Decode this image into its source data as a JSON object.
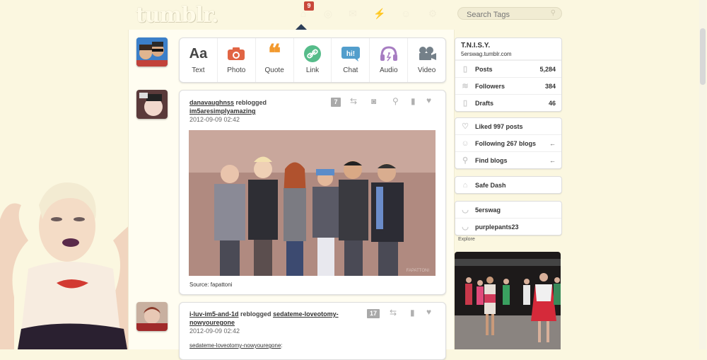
{
  "header": {
    "logo": "tumblr.",
    "notification_count": "9",
    "search_placeholder": "Search Tags"
  },
  "post_types": [
    {
      "label": "Text",
      "icon": "text-icon",
      "color": "#444444"
    },
    {
      "label": "Photo",
      "icon": "camera-icon",
      "color": "#e16544"
    },
    {
      "label": "Quote",
      "icon": "quote-icon",
      "color": "#f2992e"
    },
    {
      "label": "Link",
      "icon": "link-icon",
      "color": "#56bc8a"
    },
    {
      "label": "Chat",
      "icon": "chat-icon",
      "color": "#529ecc"
    },
    {
      "label": "Audio",
      "icon": "headphones-icon",
      "color": "#a77dc2"
    },
    {
      "label": "Video",
      "icon": "video-icon",
      "color": "#748089"
    }
  ],
  "posts": [
    {
      "user": "danavaughnss",
      "action": "reblogged",
      "source_blog": "im5aresimplyamazing",
      "date": "2012-09-09 02:42",
      "note_count": "7",
      "caption": "Source: fapattoni",
      "watermark": "FAPATTONI"
    },
    {
      "user": "i-luv-im5-and-1d",
      "action": "reblogged",
      "source_blog_line1": "sedateme-loveotomy-",
      "source_blog_line2": "nowyouregone",
      "date": "2012-09-09 02:42",
      "note_count": "17",
      "body_link": "sedateme-loveotomy-nowyouregone"
    }
  ],
  "sidebar": {
    "blog_title": "T.N.I.S.Y.",
    "blog_url": "5erswag.tumblr.com",
    "stats": [
      {
        "label": "Posts",
        "value": "5,284",
        "icon": "posts-icon"
      },
      {
        "label": "Followers",
        "value": "384",
        "icon": "followers-icon"
      },
      {
        "label": "Drafts",
        "value": "46",
        "icon": "drafts-icon"
      }
    ],
    "links": [
      {
        "label": "Liked 997 posts",
        "icon": "heart-icon"
      },
      {
        "label": "Following 267 blogs",
        "icon": "following-icon"
      },
      {
        "label": "Find blogs",
        "icon": "find-icon"
      }
    ],
    "safe_dash": "Safe Dash",
    "blogs": [
      "5erswag",
      "purplepants23"
    ],
    "explore": "Explore"
  }
}
